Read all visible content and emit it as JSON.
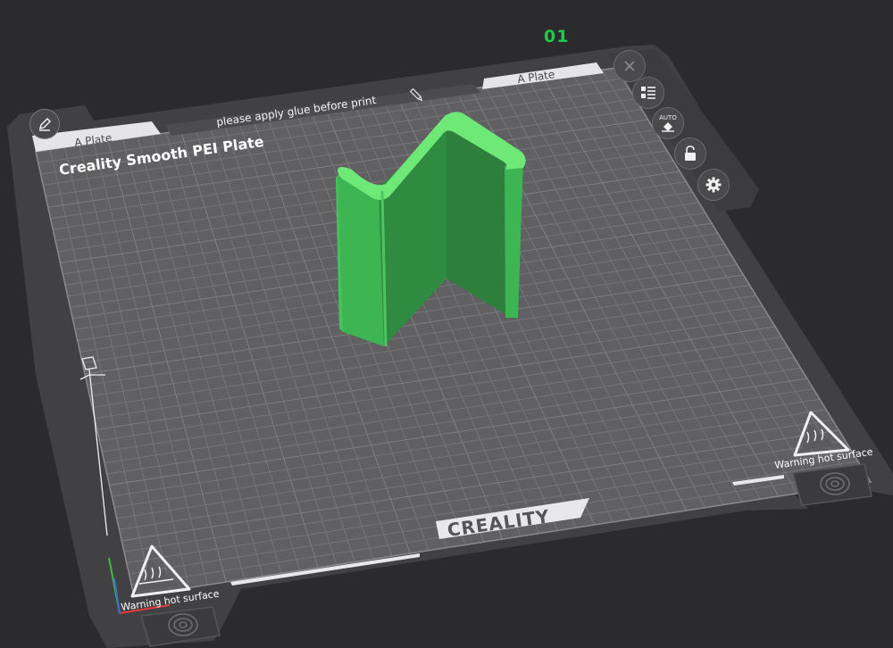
{
  "plate": {
    "number": "01",
    "tab_label_left": "A Plate",
    "tab_label_right": "A Plate",
    "note": "please apply glue before print",
    "plate_type": "Creality Smooth PEI Plate",
    "brand": "CREALITY",
    "warning_left": "Warning hot surface",
    "warning_right": "Warning hot surface"
  },
  "tools": [
    {
      "icon": "close-icon"
    },
    {
      "icon": "arrange-icon"
    },
    {
      "icon": "auto-orient-icon",
      "label": "AUTO"
    },
    {
      "icon": "lock-icon"
    },
    {
      "icon": "settings-icon"
    }
  ],
  "model": {
    "color": "#3fbd54"
  },
  "colors": {
    "background": "#2b2b2d",
    "plate": "#606062",
    "frame": "#414143",
    "accent": "#1fcc4a"
  }
}
